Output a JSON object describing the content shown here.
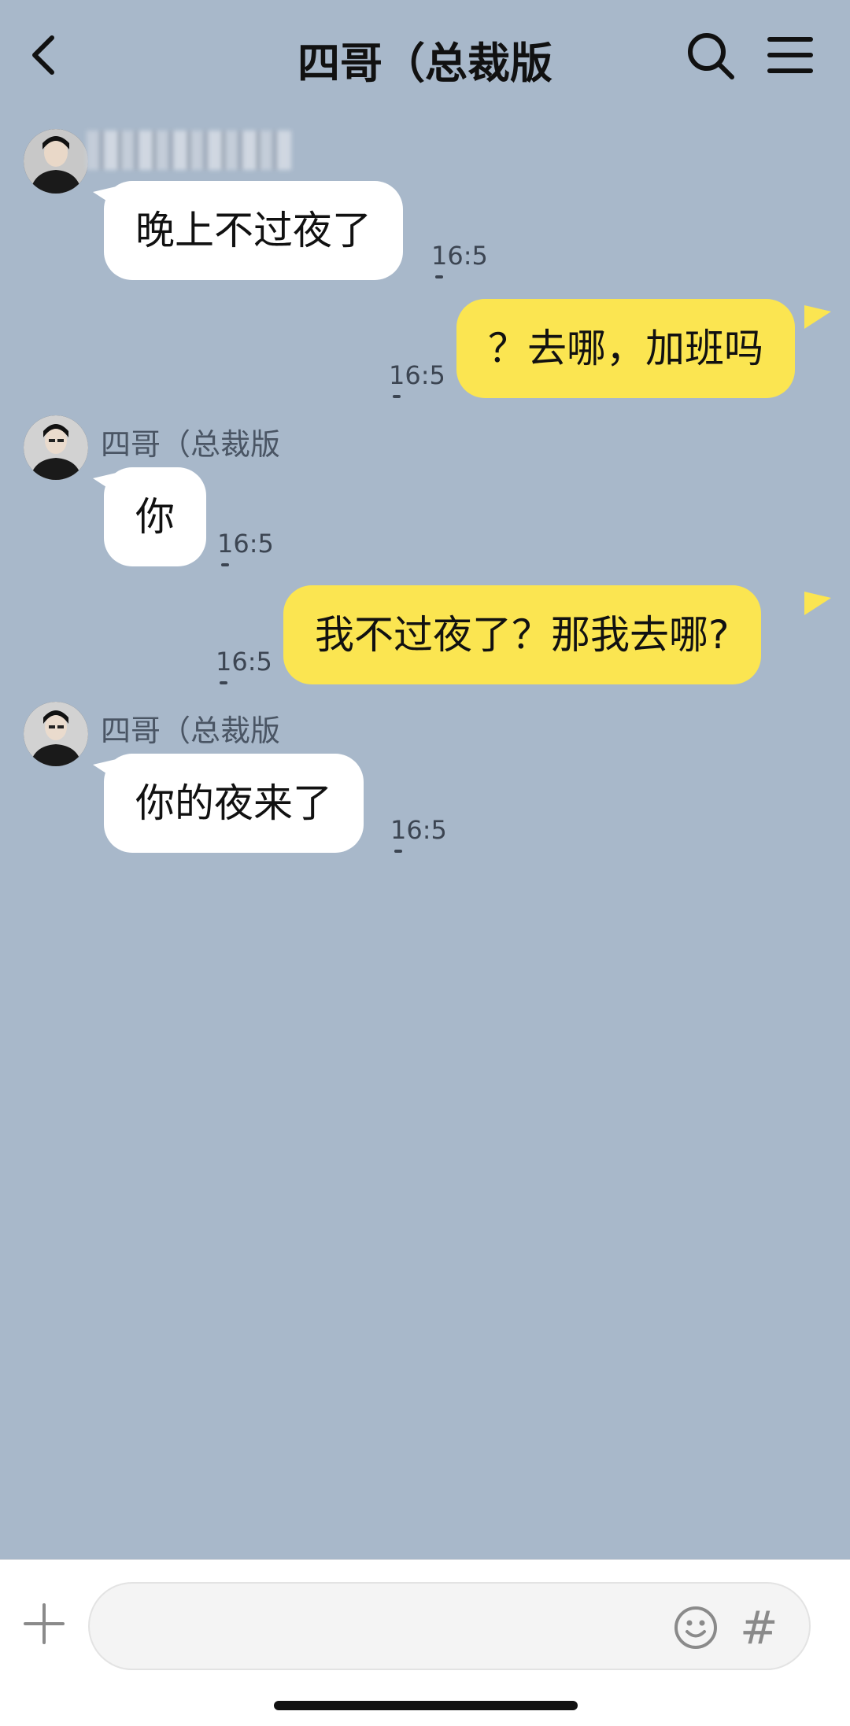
{
  "header": {
    "title": "四哥（总裁版",
    "back_icon": "chevron-left-icon",
    "search_icon": "search-icon",
    "menu_icon": "hamburger-menu-icon"
  },
  "messages": [
    {
      "side": "in",
      "sender": "",
      "text": "晚上不过夜了",
      "time": "16:5"
    },
    {
      "side": "out",
      "text": "？去哪，加班吗",
      "time": "16:5"
    },
    {
      "side": "in",
      "sender": "四哥（总裁版",
      "text": "你",
      "time": "16:5"
    },
    {
      "side": "out",
      "text": "我不过夜了？那我去哪?",
      "time": "16:5"
    },
    {
      "side": "in",
      "sender": "四哥（总裁版",
      "text": "你的夜来了",
      "time": "16:5"
    }
  ],
  "input_bar": {
    "placeholder": "",
    "plus_icon": "plus-icon",
    "emoji_icon": "emoji-icon",
    "hash_label": "#"
  },
  "colors": {
    "background": "#a8b8ca",
    "incoming_bubble": "#ffffff",
    "outgoing_bubble": "#fbe551"
  }
}
